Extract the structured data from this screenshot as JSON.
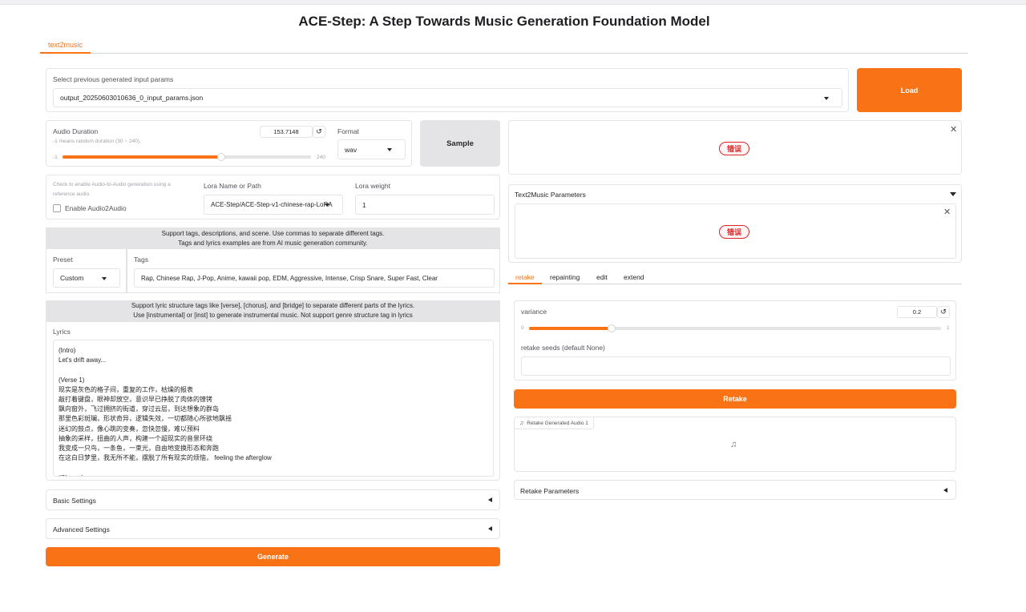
{
  "header": {
    "title": "ACE-Step: A Step Towards Music Generation Foundation Model"
  },
  "tabs": [
    {
      "label": "text2music"
    }
  ],
  "previous_params": {
    "label": "Select previous generated input params",
    "value": "output_20250603010636_0_input_params.json",
    "load_label": "Load"
  },
  "duration": {
    "label": "Audio Duration",
    "hint": "-1 means random duration (30 ~ 240).",
    "value": "153.7148",
    "min": "-1",
    "max": "240",
    "fraction": 0.64
  },
  "format": {
    "label": "Format",
    "value": "wav"
  },
  "sample_label": "Sample",
  "audio2audio": {
    "hint": "Check to enable Audio-to-Audio generation using a reference audio.",
    "label": "Enable Audio2Audio",
    "checked": false
  },
  "lora": {
    "name_label": "Lora Name or Path",
    "name_value": "ACE-Step/ACE-Step-v1-chinese-rap-LoRA",
    "weight_label": "Lora weight",
    "weight_value": "1"
  },
  "tags_info": {
    "line1": "Support tags, descriptions, and scene. Use commas to separate different tags.",
    "line2": "Tags and lyrics examples are from AI music generation community."
  },
  "preset": {
    "label": "Preset",
    "value": "Custom"
  },
  "tags": {
    "label": "Tags",
    "value": "Rap, Chinese Rap, J-Pop, Anime, kawaii pop, EDM, Aggressive, Intense, Crisp Snare, Super Fast, Clear"
  },
  "lyrics_info": {
    "line1": "Support lyric structure tags like [verse], [chorus], and [bridge] to separate different parts of the lyrics.",
    "line2": "Use [instrumental] or [inst] to generate instrumental music. Not support genre structure tag in lyrics"
  },
  "lyrics": {
    "label": "Lyrics",
    "text": "(Intro)\nLet's drift away...\n\n(Verse 1)\n现实是灰色的格子间，重复的工作，枯燥的报表\n敲打着键盘，眼神却放空，意识早已挣脱了肉体的镣铐\n飘向窗外，飞过拥挤的街道，穿过云层，到达想象的群岛\n那里色彩斑斓，形状奇异，逻辑失效，一切都随心所欲地飘摇\n迷幻的鼓点，像心跳的变奏，忽快忽慢，难以预料\n抽象的采样，扭曲的人声，构建一个超现实的音景环绕\n我变成一只鸟，一条鱼，一束光，自由地变换形态和奔跑\n在这白日梦里，我无所不能，摆脱了所有现实的烦恼， feeling the afterglow\n\n(Chorus)"
  },
  "basic_settings": {
    "label": "Basic Settings"
  },
  "advanced_settings": {
    "label": "Advanced Settings"
  },
  "generate_label": "Generate",
  "output_panel": {
    "error": "错误"
  },
  "t2m_params": {
    "label": "Text2Music Parameters",
    "error": "错误"
  },
  "subtabs": [
    {
      "label": "retake"
    },
    {
      "label": "repainting"
    },
    {
      "label": "edit"
    },
    {
      "label": "extend"
    }
  ],
  "variance": {
    "label": "variance",
    "value": "0.2",
    "min": "0",
    "max": "1",
    "fraction": 0.2
  },
  "retake_seeds": {
    "label": "retake seeds (default None)",
    "value": ""
  },
  "retake_label": "Retake",
  "retake_audio": {
    "label": "Retake Generated Audio 1"
  },
  "retake_params": {
    "label": "Retake Parameters"
  },
  "colors": {
    "accent": "#f97316",
    "error": "#dc2626",
    "muted": "#e4e4e7"
  },
  "icons": {
    "reset": "reset-icon",
    "music": "music-note-icon",
    "close": "close-icon"
  }
}
